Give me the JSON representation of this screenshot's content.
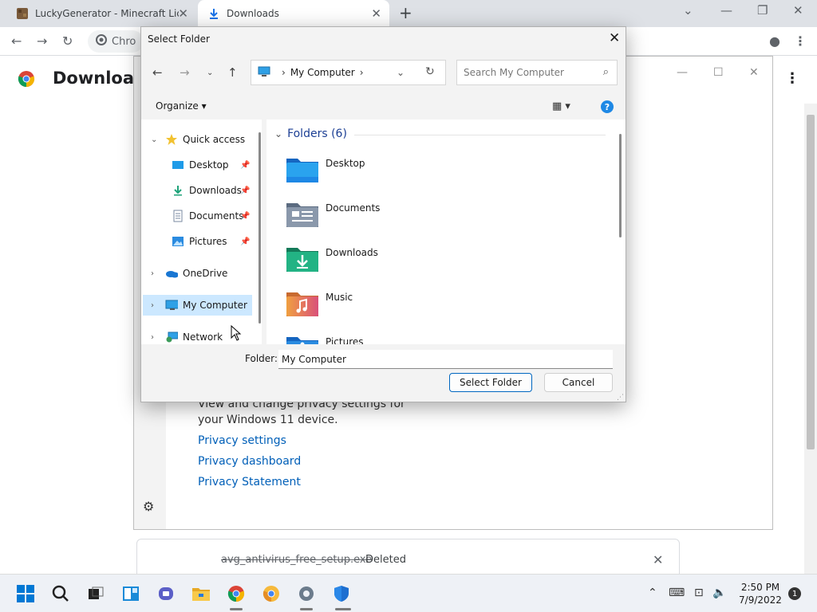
{
  "browser": {
    "tabs": [
      {
        "title": "LuckyGenerator - Minecraft Licen",
        "active": false
      },
      {
        "title": "Downloads",
        "active": true
      }
    ],
    "omnibox_text": "Chro",
    "page_title": "Download"
  },
  "settings_panel": {
    "description": "View and change privacy settings for your Windows 11 device.",
    "links": [
      "Privacy settings",
      "Privacy dashboard",
      "Privacy Statement"
    ]
  },
  "download_item": {
    "filename": "avg_antivirus_free_setup.exe",
    "status": "Deleted"
  },
  "dialog": {
    "title": "Select Folder",
    "address": {
      "location": "My Computer"
    },
    "search_placeholder": "Search My Computer",
    "organize_label": "Organize",
    "nav": {
      "quick_access": "Quick access",
      "pinned": [
        "Desktop",
        "Downloads",
        "Documents",
        "Pictures"
      ],
      "onedrive": "OneDrive",
      "my_computer": "My Computer",
      "network": "Network"
    },
    "group_header": "Folders (6)",
    "folders": [
      {
        "name": "Desktop",
        "color": "#1e88e5"
      },
      {
        "name": "Documents",
        "color": "#7a8aa0"
      },
      {
        "name": "Downloads",
        "color": "#1fa37a"
      },
      {
        "name": "Music",
        "color": "#e86a55"
      },
      {
        "name": "Pictures",
        "color": "#2a8be0"
      }
    ],
    "folder_field_label": "Folder:",
    "folder_field_value": "My Computer",
    "select_button": "Select Folder",
    "cancel_button": "Cancel"
  },
  "taskbar": {
    "time": "2:50 PM",
    "date": "7/9/2022",
    "notifications": "1"
  }
}
